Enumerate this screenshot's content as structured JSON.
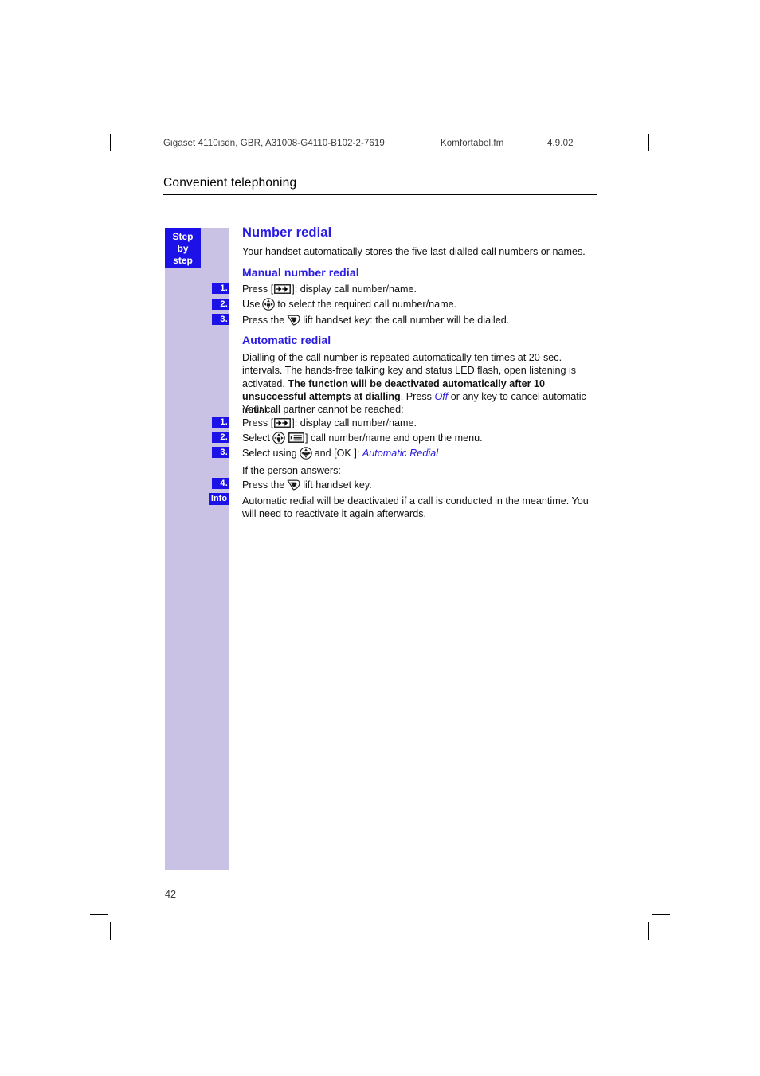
{
  "document": {
    "header": {
      "doc_id": "Gigaset 4110isdn, GBR, A31008-G4110-B102-2-7619",
      "file_name": "Komfortabel.fm",
      "date": "4.9.02"
    },
    "chapter_title": "Convenient telephoning",
    "page_number": "42"
  },
  "margin": {
    "step_by_step": [
      "Step",
      "by",
      "step"
    ],
    "badges": {
      "s1": "1.",
      "s2": "2.",
      "s3": "3.",
      "s4": "1.",
      "s5": "2.",
      "s6": "3.",
      "s7": "4.",
      "info": "Info"
    }
  },
  "content": {
    "heading_main": "Number redial",
    "intro": "Your handset automatically stores the five last-dialled call numbers or names.",
    "manual": {
      "heading": "Manual number redial",
      "step1_a": "Press [",
      "step1_b": "]: display call number/name.",
      "step2_a": "Use",
      "step2_b": "to select the required call number/name.",
      "step3_a": "Press the",
      "step3_b": "lift handset key: the call number will be dialled."
    },
    "automatic": {
      "heading": "Automatic redial",
      "para_1": "Dialling of the call number is repeated automatically ten times at 20-sec. intervals. The hands-free talking key and status LED flash, open listening is activated. ",
      "para_1_bold": "The function will be deactivated automatically after 10 unsuccessful attempts at dialling",
      "para_1_tail_a": ". Press ",
      "para_1_off": "Off",
      "para_1_tail_b": " or any key to cancel automatic redial.",
      "lead_in": "Your call partner cannot be reached:",
      "step1_a": "Press [",
      "step1_b": "]: display call number/name.",
      "step2_a": "Select",
      "step2_b": "]",
      "step2_c": "call number/name and open the menu.",
      "step3_a": "Select using",
      "step3_b": "and [OK ]:",
      "step3_italic": "Automatic Redial",
      "answers": "If the person answers:",
      "step4_a": "Press the",
      "step4_b": "lift handset key.",
      "info": "Automatic redial will be deactivated if a call is conducted in the meantime. You will need to reactivate it again afterwards."
    }
  },
  "colors": {
    "heading_blue": "#2a1ce0",
    "badge_blue": "#1c12e8",
    "margin_band": "#c9c2e4"
  }
}
